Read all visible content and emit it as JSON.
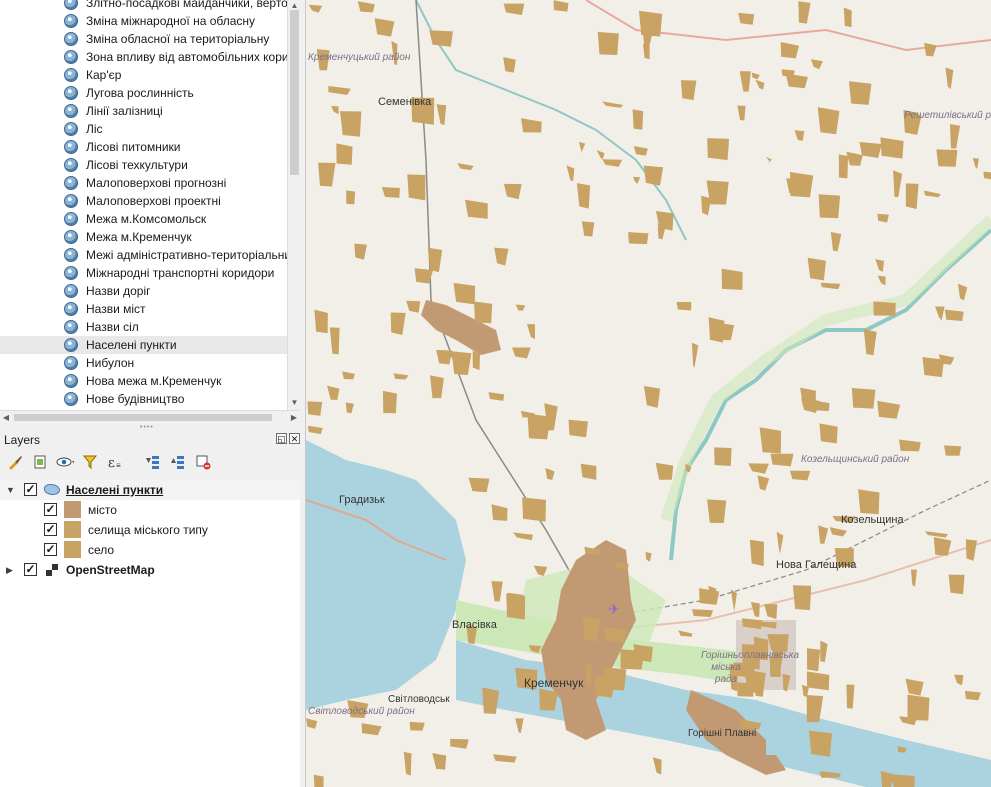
{
  "browser": {
    "items": [
      {
        "label": "Злітно-посадкові майданчики, вертол"
      },
      {
        "label": "Зміна міжнародної на обласну"
      },
      {
        "label": "Зміна обласної на територіальну"
      },
      {
        "label": "Зона впливу від автомобільних корид"
      },
      {
        "label": "Кар'єр"
      },
      {
        "label": "Лугова рослинність"
      },
      {
        "label": "Лінії залізниці"
      },
      {
        "label": "Ліс"
      },
      {
        "label": "Лісові питомники"
      },
      {
        "label": "Лісові техкультури"
      },
      {
        "label": "Малоповерхові прогнозні"
      },
      {
        "label": "Малоповерхові проектні"
      },
      {
        "label": "Межа м.Комсомольск"
      },
      {
        "label": "Межа м.Кременчук"
      },
      {
        "label": "Межі адміністративно-територіальни"
      },
      {
        "label": "Міжнародні транспортні коридори"
      },
      {
        "label": "Назви доріг"
      },
      {
        "label": "Назви міст"
      },
      {
        "label": "Назви сіл"
      },
      {
        "label": "Населені пункти",
        "selected": true
      },
      {
        "label": "Нибулон"
      },
      {
        "label": "Нова межа м.Кременчук"
      },
      {
        "label": "Нове будівництво"
      }
    ]
  },
  "layers_panel": {
    "title": "Layers",
    "float_btn": "◱",
    "close_btn": "✕",
    "tree": {
      "group_layer": {
        "name": "Населені пункти"
      },
      "classes": [
        {
          "label": "місто",
          "color": "#c19a74"
        },
        {
          "label": "селища міського типу",
          "color": "#c9a363"
        },
        {
          "label": "село",
          "color": "#c9a363"
        }
      ],
      "base_layer": {
        "name": "OpenStreetMap"
      }
    }
  },
  "colors": {
    "city": "#c19a74",
    "village": "#c9a363",
    "water": "#aad3df",
    "green": "#cde8b8",
    "background": "#f2efe9"
  },
  "map": {
    "labels": {
      "kremenchuk_district": "Кременчуцький район",
      "semenivka": "Семенівка",
      "reshetylivka_district": "Решетилівський район",
      "kozelshchyna_district": "Козельщинський район",
      "kozelshchyna": "Козельщина",
      "nova_galeshchyna": "Нова Галещина",
      "gradyzk": "Градизьк",
      "vlasivka": "Власівка",
      "kremenchuk": "Кременчук",
      "svitlovodsk": "Світловодськ",
      "svitlovodsk_district": "Світловодський район",
      "horishni_plavni_rada": "Горішньоплавнівська міська рада",
      "horishni_plavni": "Горішні Плавні"
    }
  }
}
